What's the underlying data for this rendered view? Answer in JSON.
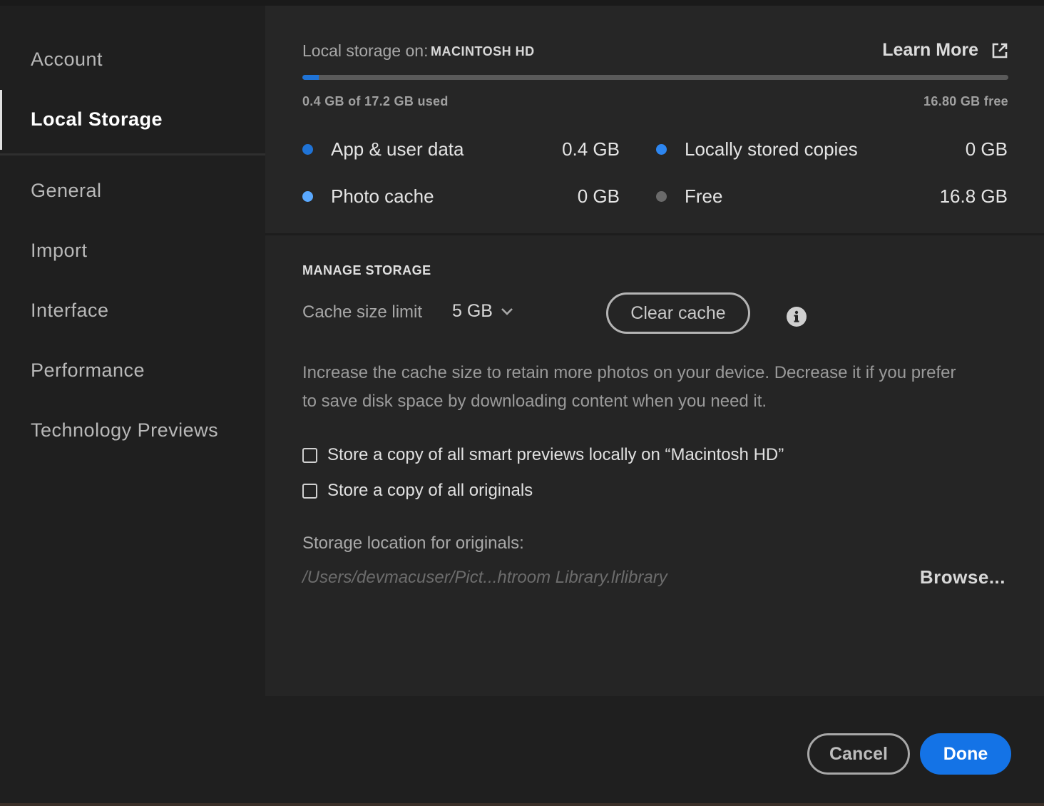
{
  "sidebar": {
    "items": [
      {
        "label": "Account",
        "active": false
      },
      {
        "label": "Local Storage",
        "active": true
      },
      {
        "label": "General",
        "active": false
      },
      {
        "label": "Import",
        "active": false
      },
      {
        "label": "Interface",
        "active": false
      },
      {
        "label": "Performance",
        "active": false
      },
      {
        "label": "Technology Previews",
        "active": false
      }
    ]
  },
  "storage": {
    "label": "Local storage on:",
    "drive": "MACINTOSH HD",
    "learn_more": "Learn More",
    "used_fraction": 0.023,
    "used_text": "0.4 GB of 17.2 GB used",
    "free_text": "16.80 GB free",
    "legend": [
      {
        "label": "App & user data",
        "value": "0.4 GB",
        "color": "#1f73d6"
      },
      {
        "label": "Locally stored copies",
        "value": "0 GB",
        "color": "#2d86f0"
      },
      {
        "label": "Photo cache",
        "value": "0 GB",
        "color": "#5aa9ff"
      },
      {
        "label": "Free",
        "value": "16.8 GB",
        "color": "#6a6a6a"
      }
    ]
  },
  "manage": {
    "title": "MANAGE STORAGE",
    "cache_label": "Cache size limit",
    "cache_value": "5 GB",
    "clear_cache": "Clear cache",
    "description": "Increase the cache size to retain more photos on your device. Decrease it if you prefer to save disk space by downloading content when you need it.",
    "checkbox_smart_previews": "Store a copy of all smart previews locally on “Macintosh HD”",
    "checkbox_originals": "Store a copy of all originals",
    "location_label": "Storage location for originals:",
    "location_path": "/Users/devmacuser/Pict...htroom Library.lrlibrary",
    "browse": "Browse..."
  },
  "footer": {
    "cancel": "Cancel",
    "done": "Done"
  },
  "colors": {
    "accent": "#1473e6",
    "background": "#1f1f1f"
  }
}
